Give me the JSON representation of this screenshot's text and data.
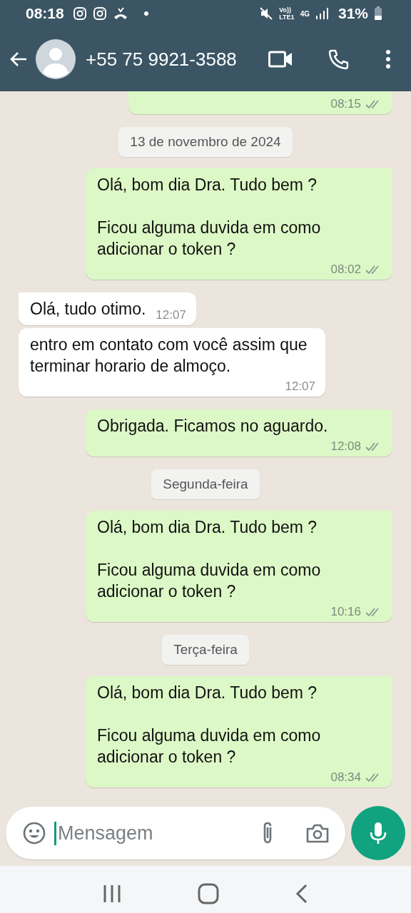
{
  "status_bar": {
    "time": "08:18",
    "volte": "Vo))",
    "lte": "LTE1",
    "network": "4G",
    "battery": "31%"
  },
  "header": {
    "contact": "+55 75 9921-3588"
  },
  "messages": [
    {
      "kind": "out",
      "time": "08:15",
      "read": false,
      "cut": true
    },
    {
      "kind": "date",
      "text": "13 de novembro de 2024"
    },
    {
      "kind": "out",
      "text": "Olá, bom dia Dra. Tudo bem ?\n\nFicou alguma duvida em como adicionar o token ?",
      "time": "08:02",
      "read": false,
      "cut": false
    },
    {
      "kind": "in",
      "text": "Olá, tudo otimo.",
      "time": "12:07",
      "tail": true
    },
    {
      "kind": "in",
      "text": "entro em contato com você assim que terminar horario de almoço.",
      "time": "12:07",
      "tail": false
    },
    {
      "kind": "out",
      "text": "Obrigada. Ficamos no aguardo.",
      "time": "12:08",
      "read": false,
      "cut": false
    },
    {
      "kind": "date",
      "text": "Segunda-feira"
    },
    {
      "kind": "out",
      "text": "Olá, bom dia Dra. Tudo bem ?\n\nFicou alguma duvida em como adicionar o token ?",
      "time": "10:16",
      "read": false,
      "cut": false
    },
    {
      "kind": "date",
      "text": "Terça-feira"
    },
    {
      "kind": "out",
      "text": "Olá, bom dia Dra. Tudo bem ?\n\nFicou alguma duvida em como adicionar o token ?",
      "time": "08:34",
      "read": false,
      "cut": false
    }
  ],
  "composer": {
    "placeholder": "Mensagem"
  }
}
